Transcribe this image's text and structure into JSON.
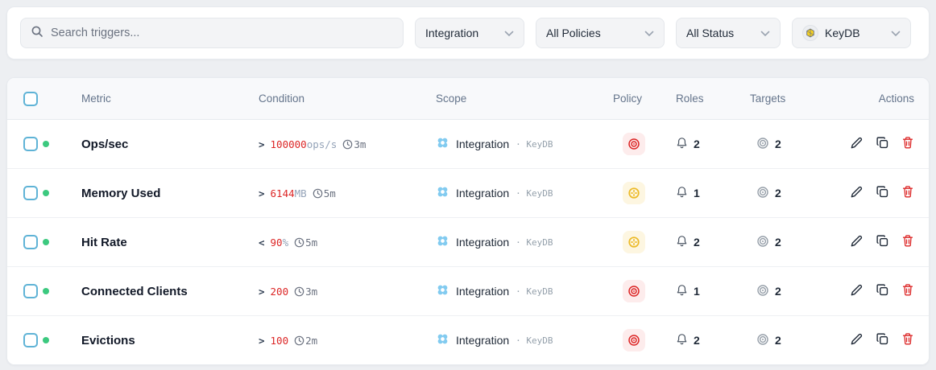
{
  "colors": {
    "page-bg": "#edeff2",
    "card-bg": "#ffffff",
    "card-border": "#e7eaee",
    "header-bg": "#f8f9fb",
    "row-border": "#eef0f3",
    "text-dark": "#111827",
    "text-muted": "#64748b",
    "mono-red": "#dc2626",
    "green-status": "#3cc97f",
    "checkbox-blue": "#5fb3d6",
    "scope-blue": "#82cbf0",
    "critical-bg": "#fdecec",
    "critical-fg": "#dc2626",
    "warning-bg": "#fdf6e1",
    "warning-fg": "#ecba28",
    "action-red": "#dc2626"
  },
  "filters": {
    "search_placeholder": "Search triggers...",
    "dropdowns": [
      {
        "label": "Integration"
      },
      {
        "label": "All Policies"
      },
      {
        "label": "All Status"
      },
      {
        "label": "KeyDB",
        "icon": "keydb-logo"
      }
    ]
  },
  "table": {
    "headers": {
      "metric": "Metric",
      "condition": "Condition",
      "scope": "Scope",
      "policy": "Policy",
      "roles": "Roles",
      "targets": "Targets",
      "actions": "Actions"
    },
    "rows": [
      {
        "metric": "Ops/sec",
        "operator": ">",
        "value": "100000",
        "unit": "ops/s",
        "window": "3m",
        "scope": "Integration",
        "scope_sub": "· KeyDB",
        "policy": "critical",
        "roles": "2",
        "targets": "2"
      },
      {
        "metric": "Memory Used",
        "operator": ">",
        "value": "6144",
        "unit": "MB",
        "window": "5m",
        "scope": "Integration",
        "scope_sub": "· KeyDB",
        "policy": "warning",
        "roles": "1",
        "targets": "2"
      },
      {
        "metric": "Hit Rate",
        "operator": "<",
        "value": "90",
        "unit": "%",
        "window": "5m",
        "scope": "Integration",
        "scope_sub": "· KeyDB",
        "policy": "warning",
        "roles": "2",
        "targets": "2"
      },
      {
        "metric": "Connected Clients",
        "operator": ">",
        "value": "200",
        "unit": "",
        "window": "3m",
        "scope": "Integration",
        "scope_sub": "· KeyDB",
        "policy": "critical",
        "roles": "1",
        "targets": "2"
      },
      {
        "metric": "Evictions",
        "operator": ">",
        "value": "100",
        "unit": "",
        "window": "2m",
        "scope": "Integration",
        "scope_sub": "· KeyDB",
        "policy": "critical",
        "roles": "2",
        "targets": "2"
      }
    ]
  }
}
